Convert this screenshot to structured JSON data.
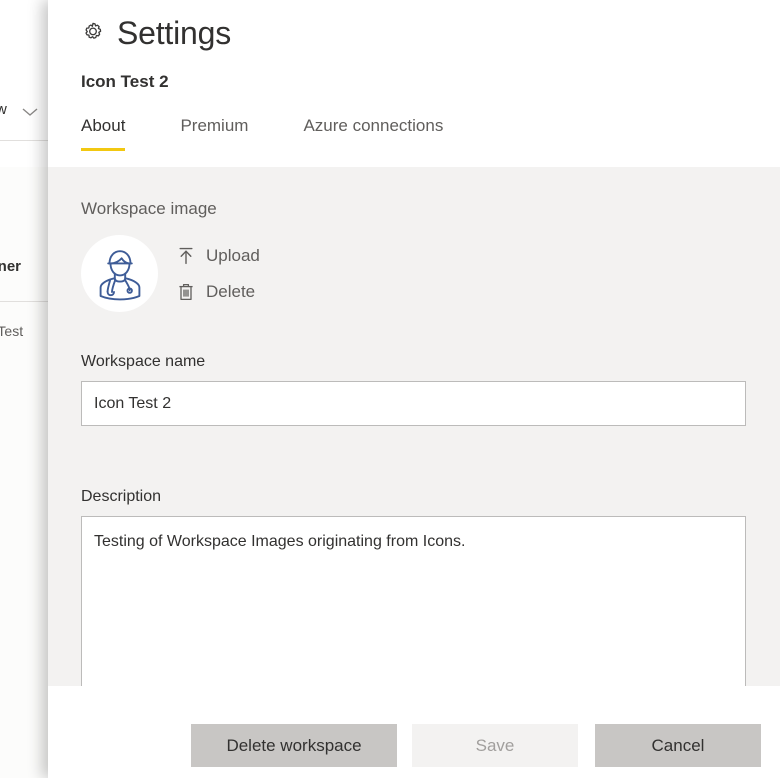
{
  "background_page": {
    "toolbar_label": "w",
    "chevron_icon": "chevron-down-icon",
    "column_header_owner": "wner",
    "cell_workspace_name": "n Test"
  },
  "panel": {
    "gear_icon": "gear-icon",
    "title": "Settings",
    "subtitle": "Icon Test 2",
    "tabs": [
      {
        "label": "About",
        "active": true
      },
      {
        "label": "Premium",
        "active": false
      },
      {
        "label": "Azure connections",
        "active": false
      }
    ],
    "workspace_image": {
      "label": "Workspace image",
      "avatar_icon": "doctor-avatar-icon",
      "avatar_color": "#3e5c97",
      "avatar_background": "#ffffff",
      "upload": {
        "label": "Upload",
        "icon": "upload-arrow-icon"
      },
      "delete": {
        "label": "Delete",
        "icon": "trash-icon"
      }
    },
    "workspace_name": {
      "label": "Workspace name",
      "value": "Icon Test 2",
      "placeholder": "Workspace name"
    },
    "description": {
      "label": "Description",
      "value": "Testing of Workspace Images originating from Icons.",
      "placeholder": "Description"
    },
    "footer": {
      "delete_workspace_label": "Delete workspace",
      "save_label": "Save",
      "cancel_label": "Cancel"
    }
  },
  "colors": {
    "accent_tab_underline": "#f2c811",
    "body_background": "#f3f2f1",
    "button_default": "#c8c6c4",
    "button_disabled": "#f3f2f1",
    "text_primary": "#323130",
    "text_secondary": "#605e5c"
  }
}
